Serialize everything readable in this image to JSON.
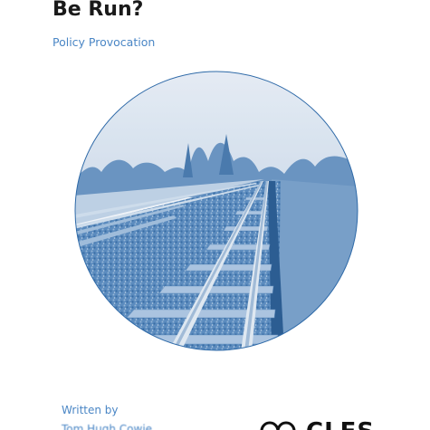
{
  "document": {
    "title": "Be Run?",
    "label": "Policy Provocation",
    "written_by_label": "Written by",
    "author_partial": "Tom Hugh Cowie",
    "logo_text": "CLES"
  },
  "cover_image": {
    "subject": "railway tracks",
    "tint_color": "#2f6aa8",
    "sky_color": "#eef3f8"
  },
  "colors": {
    "accent": "#4a86c5",
    "title": "#1a1a1a",
    "logo": "#111111"
  }
}
